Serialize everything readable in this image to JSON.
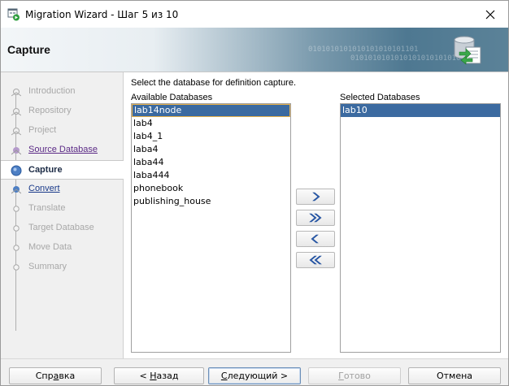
{
  "window": {
    "title": "Migration Wizard - Шаг 5 из 10",
    "close_glyph": "✕"
  },
  "header": {
    "title": "Capture",
    "binary_line1": "0101010101010101010101101",
    "binary_line2": "0101010101010101010101010"
  },
  "steps": [
    {
      "label": "Introduction",
      "state": "done"
    },
    {
      "label": "Repository",
      "state": "done"
    },
    {
      "label": "Project",
      "state": "done"
    },
    {
      "label": "Source Database",
      "state": "link"
    },
    {
      "label": "Capture",
      "state": "current"
    },
    {
      "label": "Convert",
      "state": "link"
    },
    {
      "label": "Translate",
      "state": "todo"
    },
    {
      "label": "Target Database",
      "state": "todo"
    },
    {
      "label": "Move Data",
      "state": "todo"
    },
    {
      "label": "Summary",
      "state": "todo"
    }
  ],
  "content": {
    "instruction": "Select the database for definition capture.",
    "available_label": "Available Databases",
    "selected_label": "Selected Databases",
    "available": [
      {
        "name": "lab14node",
        "selected": true
      },
      {
        "name": "lab4",
        "selected": false
      },
      {
        "name": "lab4_1",
        "selected": false
      },
      {
        "name": "laba4",
        "selected": false
      },
      {
        "name": "laba44",
        "selected": false
      },
      {
        "name": "laba444",
        "selected": false
      },
      {
        "name": "phonebook",
        "selected": false
      },
      {
        "name": "publishing_house",
        "selected": false
      }
    ],
    "selected": [
      {
        "name": "lab10",
        "selected": true
      }
    ]
  },
  "move_buttons": [
    {
      "name": "move-right-button",
      "icon": "chevron-right-icon"
    },
    {
      "name": "move-all-right-button",
      "icon": "double-chevron-right-icon"
    },
    {
      "name": "move-left-button",
      "icon": "chevron-left-icon"
    },
    {
      "name": "move-all-left-button",
      "icon": "double-chevron-left-icon"
    }
  ],
  "footer": {
    "help": {
      "pre": "Спр",
      "mn": "а",
      "post": "вка"
    },
    "back": {
      "pre": "< ",
      "mn": "Н",
      "post": "азад"
    },
    "next": {
      "pre": "",
      "mn": "С",
      "post": "ледующий >"
    },
    "finish": {
      "pre": "",
      "mn": "Г",
      "post": "отово"
    },
    "cancel": {
      "pre": "Отмена",
      "mn": "",
      "post": ""
    }
  },
  "colors": {
    "selection": "#3b6aa0",
    "focus_border": "#e8b14a",
    "link_purple": "#5b2a86",
    "link_blue": "#1a3a8a",
    "current_text": "#1c2b45"
  }
}
